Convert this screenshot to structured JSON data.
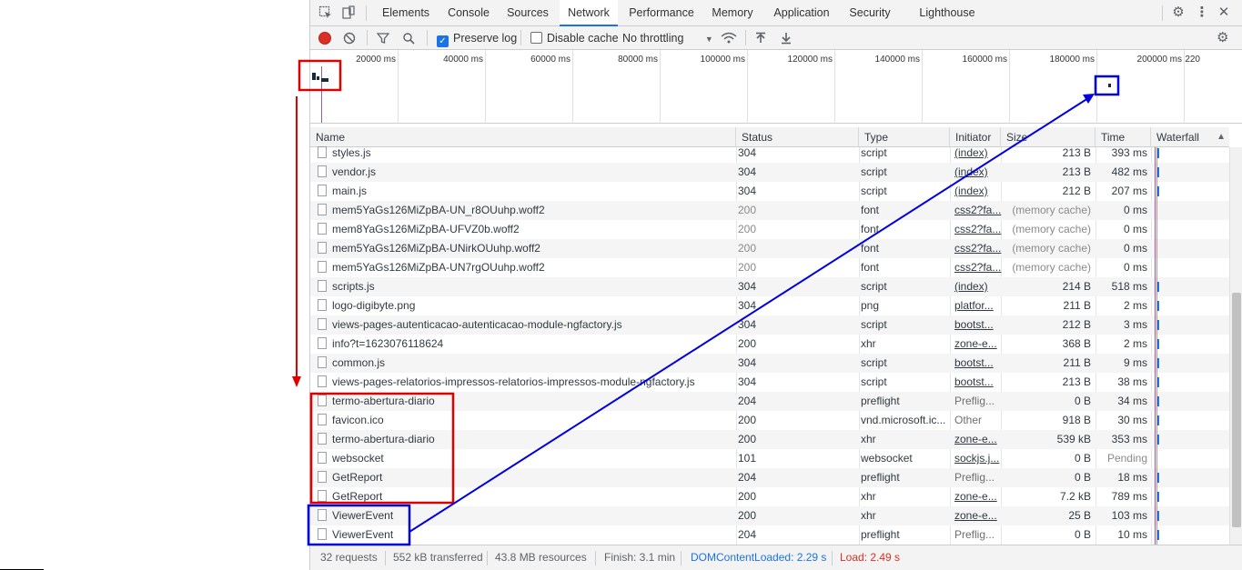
{
  "tabs": [
    "Elements",
    "Console",
    "Sources",
    "Network",
    "Performance",
    "Memory",
    "Application",
    "Security",
    "Lighthouse"
  ],
  "active_tab": "Network",
  "toolbar": {
    "preserve_log": "Preserve log",
    "disable_cache": "Disable cache",
    "throttling": "No throttling"
  },
  "overview": {
    "ticks": [
      "20000 ms",
      "40000 ms",
      "60000 ms",
      "80000 ms",
      "100000 ms",
      "120000 ms",
      "140000 ms",
      "160000 ms",
      "180000 ms",
      "200000 ms",
      "220"
    ]
  },
  "columns": {
    "name": "Name",
    "status": "Status",
    "type": "Type",
    "initiator": "Initiator",
    "size": "Size",
    "time": "Time",
    "waterfall": "Waterfall"
  },
  "rows": [
    {
      "name": "styles.js",
      "status": "304",
      "type": "script",
      "initiator": "(index)",
      "size": "213 B",
      "time": "393 ms"
    },
    {
      "name": "vendor.js",
      "status": "304",
      "type": "script",
      "initiator": "(index)",
      "size": "213 B",
      "time": "482 ms"
    },
    {
      "name": "main.js",
      "status": "304",
      "type": "script",
      "initiator": "(index)",
      "size": "212 B",
      "time": "207 ms"
    },
    {
      "name": "mem5YaGs126MiZpBA-UN_r8OUuhp.woff2",
      "status": "200",
      "type": "font",
      "initiator": "css2?fa...",
      "size": "(memory cache)",
      "time": "0 ms"
    },
    {
      "name": "mem8YaGs126MiZpBA-UFVZ0b.woff2",
      "status": "200",
      "type": "font",
      "initiator": "css2?fa...",
      "size": "(memory cache)",
      "time": "0 ms"
    },
    {
      "name": "mem5YaGs126MiZpBA-UNirkOUuhp.woff2",
      "status": "200",
      "type": "font",
      "initiator": "css2?fa...",
      "size": "(memory cache)",
      "time": "0 ms"
    },
    {
      "name": "mem5YaGs126MiZpBA-UN7rgOUuhp.woff2",
      "status": "200",
      "type": "font",
      "initiator": "css2?fa...",
      "size": "(memory cache)",
      "time": "0 ms"
    },
    {
      "name": "scripts.js",
      "status": "304",
      "type": "script",
      "initiator": "(index)",
      "size": "214 B",
      "time": "518 ms"
    },
    {
      "name": "logo-digibyte.png",
      "status": "304",
      "type": "png",
      "initiator": "platfor...",
      "size": "211 B",
      "time": "2 ms"
    },
    {
      "name": "views-pages-autenticacao-autenticacao-module-ngfactory.js",
      "status": "304",
      "type": "script",
      "initiator": "bootst...",
      "size": "212 B",
      "time": "3 ms"
    },
    {
      "name": "info?t=1623076118624",
      "status": "200",
      "type": "xhr",
      "initiator": "zone-e...",
      "size": "368 B",
      "time": "2 ms"
    },
    {
      "name": "common.js",
      "status": "304",
      "type": "script",
      "initiator": "bootst...",
      "size": "211 B",
      "time": "9 ms"
    },
    {
      "name": "views-pages-relatorios-impressos-relatorios-impressos-module-ngfactory.js",
      "status": "304",
      "type": "script",
      "initiator": "bootst...",
      "size": "213 B",
      "time": "38 ms"
    },
    {
      "name": "termo-abertura-diario",
      "status": "204",
      "type": "preflight",
      "initiator": "Preflig...",
      "size": "0 B",
      "time": "34 ms"
    },
    {
      "name": "favicon.ico",
      "status": "200",
      "type": "vnd.microsoft.ic...",
      "initiator": "Other",
      "size": "918 B",
      "time": "30 ms"
    },
    {
      "name": "termo-abertura-diario",
      "status": "200",
      "type": "xhr",
      "initiator": "zone-e...",
      "size": "539 kB",
      "time": "353 ms"
    },
    {
      "name": "websocket",
      "status": "101",
      "type": "websocket",
      "initiator": "sockjs.j...",
      "size": "0 B",
      "time": "Pending"
    },
    {
      "name": "GetReport",
      "status": "204",
      "type": "preflight",
      "initiator": "Preflig...",
      "size": "0 B",
      "time": "18 ms"
    },
    {
      "name": "GetReport",
      "status": "200",
      "type": "xhr",
      "initiator": "zone-e...",
      "size": "7.2 kB",
      "time": "789 ms"
    },
    {
      "name": "ViewerEvent",
      "status": "200",
      "type": "xhr",
      "initiator": "zone-e...",
      "size": "25 B",
      "time": "103 ms"
    },
    {
      "name": "ViewerEvent",
      "status": "204",
      "type": "preflight",
      "initiator": "Preflig...",
      "size": "0 B",
      "time": "10 ms"
    }
  ],
  "statusbar": {
    "requests": "32 requests",
    "transferred": "552 kB transferred",
    "resources": "43.8 MB resources",
    "finish": "Finish: 3.1 min",
    "domcontentloaded": "DOMContentLoaded: 2.29 s",
    "load": "Load: 2.49 s"
  },
  "colors": {
    "accent": "#1a73e8",
    "record": "#d93025",
    "annotation_red": "#e00000",
    "annotation_blue": "#0000e0",
    "domcontentloaded": "#1a73e8",
    "load": "#d93025"
  }
}
